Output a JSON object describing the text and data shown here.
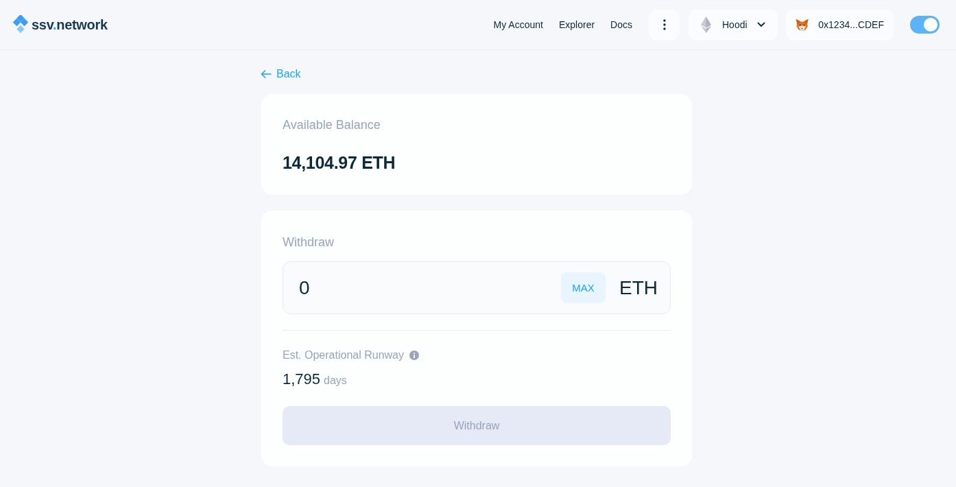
{
  "header": {
    "logo": "ssv.network",
    "nav_links": [
      "My Account",
      "Explorer",
      "Docs"
    ],
    "network_selector": {
      "label": "Hoodi"
    },
    "wallet_button": {
      "address": "0x1234...CDEF"
    },
    "theme_toggle": {
      "on": true
    }
  },
  "back_link": "Back",
  "balance_card": {
    "label": "Available Balance",
    "amount": "14,104.97 ETH"
  },
  "withdraw_card": {
    "title": "Withdraw",
    "amount_field": {
      "value": "0",
      "max_button": "MAX",
      "unit": "ETH"
    },
    "runway": {
      "label": "Est. Operational Runway",
      "value": "1,795",
      "unit": "days"
    },
    "submit_button": {
      "label": "Withdraw",
      "disabled": true
    }
  }
}
